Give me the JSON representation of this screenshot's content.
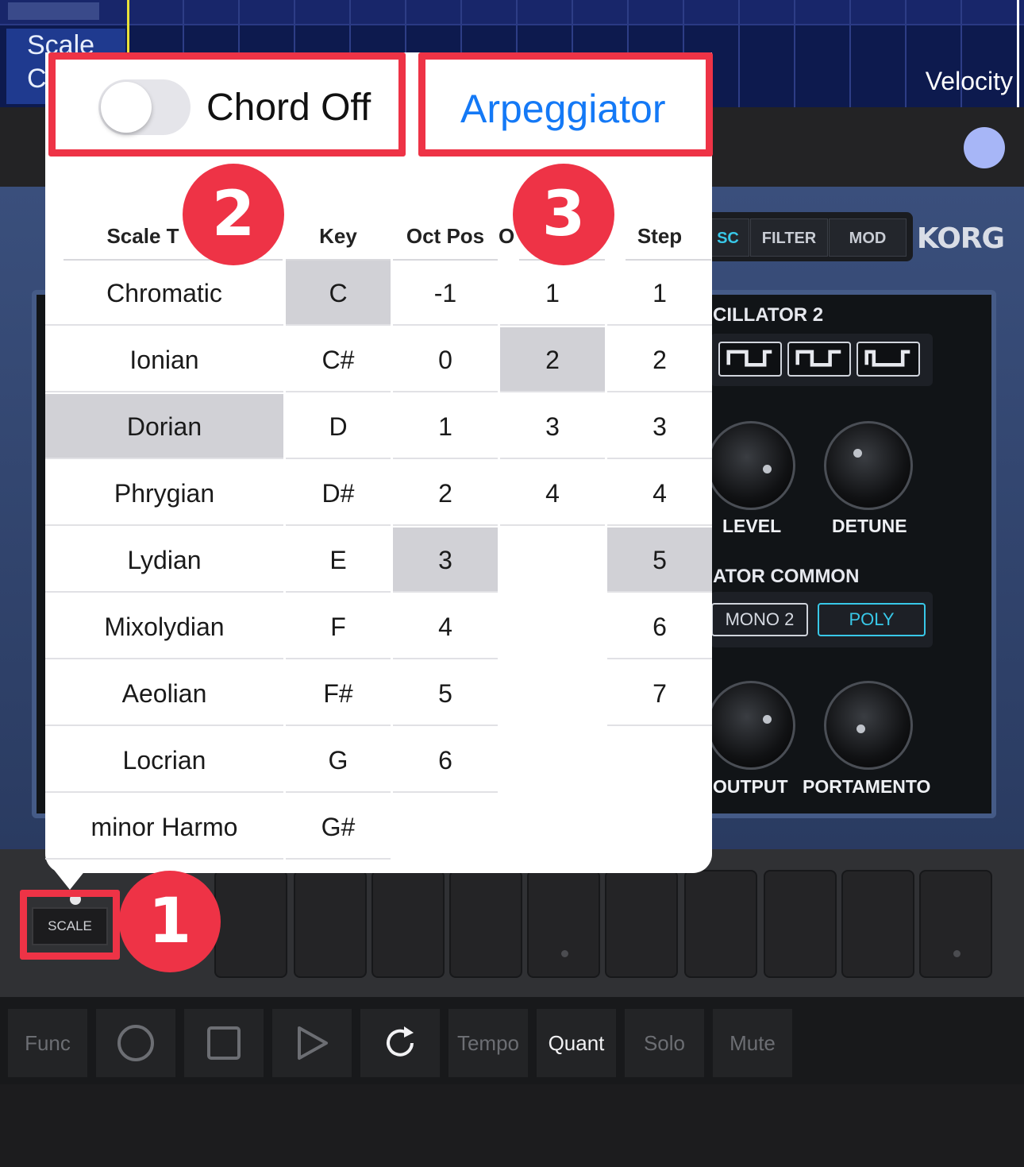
{
  "roll": {
    "scale_label": "Scale",
    "scale_label_cut": "C",
    "velocity_label": "Velocity"
  },
  "synth": {
    "tabs": [
      "SC",
      "FILTER",
      "MOD"
    ],
    "brand": "KORG",
    "oscillator2_title": "CILLATOR 2",
    "common_title": "ATOR COMMON",
    "knobs": {
      "level": "LEVEL",
      "detune": "DETUNE",
      "output": "OUTPUT",
      "portamento": "PORTAMENTO"
    },
    "modes": {
      "mono2": "MONO 2",
      "poly": "POLY"
    },
    "accent_color": "#38c8e8"
  },
  "pads": {
    "scale_button": "SCALE"
  },
  "transport": {
    "func": "Func",
    "record_icon": "circle-icon",
    "stop_icon": "square-icon",
    "play_icon": "play-icon",
    "loop_icon": "loop-icon",
    "tempo": "Tempo",
    "quant": "Quant",
    "solo": "Solo",
    "mute": "Mute"
  },
  "popover": {
    "chord_toggle_label": "Chord Off",
    "chord_toggle_on": false,
    "arpeggiator_label": "Arpeggiator",
    "headers": {
      "scale_type": "Scale T",
      "key": "Key",
      "oct_pos": "Oct Pos",
      "oct": "O",
      "step": "Step"
    },
    "scale_types": [
      "Chromatic",
      "Ionian",
      "Dorian",
      "Phrygian",
      "Lydian",
      "Mixolydian",
      "Aeolian",
      "Locrian",
      "minor Harmo"
    ],
    "scale_type_selected": "Dorian",
    "keys": [
      "C",
      "C#",
      "D",
      "D#",
      "E",
      "F",
      "F#",
      "G",
      "G#"
    ],
    "key_selected": "C",
    "oct_pos": [
      "-1",
      "0",
      "1",
      "2",
      "3",
      "4",
      "5",
      "6"
    ],
    "oct_pos_selected": "3",
    "oct": [
      "1",
      "2",
      "3",
      "4"
    ],
    "oct_selected": "2",
    "steps": [
      "1",
      "2",
      "3",
      "4",
      "5",
      "6",
      "7"
    ],
    "step_selected": "5"
  },
  "callouts": {
    "one": "1",
    "two": "2",
    "three": "3",
    "color": "#ee3346"
  }
}
